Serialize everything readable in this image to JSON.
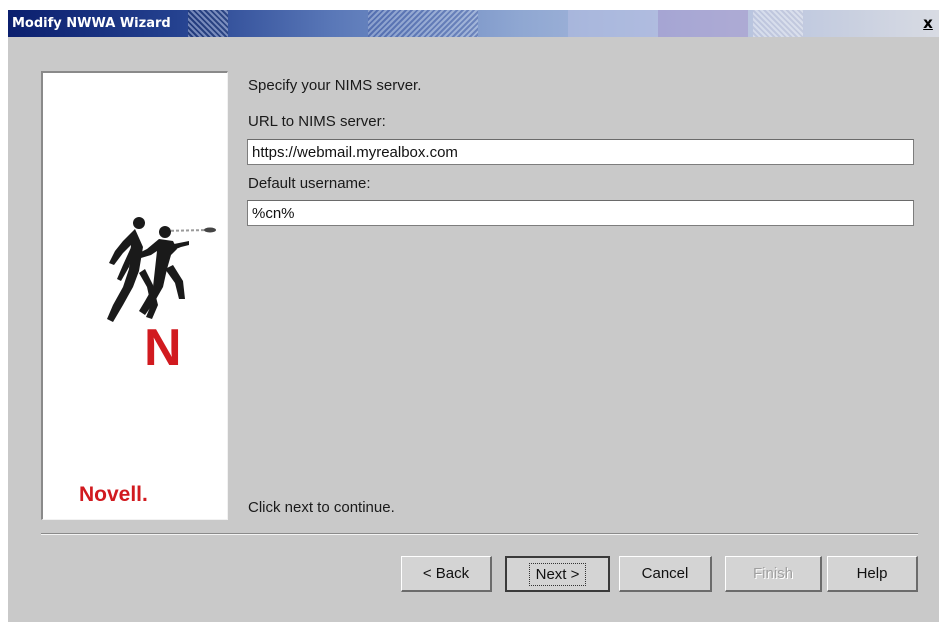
{
  "window": {
    "title": "Modify NWWA Wizard",
    "close_label": "x"
  },
  "side_panel": {
    "logo_text": "Novell.",
    "logo_letter": "N"
  },
  "main": {
    "prompt": "Specify your NIMS server.",
    "url_label": "URL to NIMS server:",
    "url_value": "https://webmail.myrealbox.com",
    "username_label": "Default username:",
    "username_value": "%cn%",
    "footer_text": "Click next to continue."
  },
  "buttons": {
    "back": "< Back",
    "next": "Next >",
    "cancel": "Cancel",
    "finish": "Finish",
    "help": "Help"
  },
  "colors": {
    "accent_red": "#d11a1f",
    "titlebar_dark": "#0b1f6e"
  }
}
